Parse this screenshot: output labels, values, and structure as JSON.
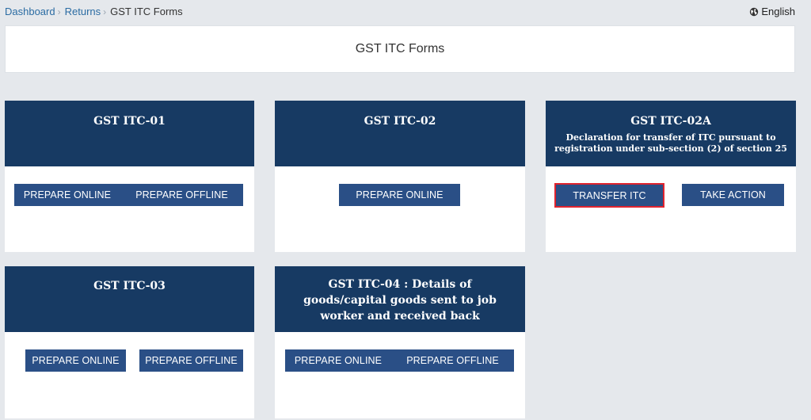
{
  "breadcrumb": {
    "items": [
      "Dashboard",
      "Returns"
    ],
    "current": "GST ITC Forms",
    "separator": "›"
  },
  "language": {
    "label": "English",
    "icon": "globe-icon"
  },
  "page_title": "GST ITC Forms",
  "cards": {
    "itc01": {
      "title": "GST ITC-01",
      "btn1": "PREPARE ONLINE",
      "btn2": "PREPARE OFFLINE"
    },
    "itc02": {
      "title": "GST ITC-02",
      "btn1": "PREPARE ONLINE"
    },
    "itc02a": {
      "title": "GST ITC-02A",
      "subtitle_line1": "Declaration for transfer of ITC pursuant to",
      "subtitle_line2": "registration under sub-section (2) of section 25",
      "btn1": "TRANSFER ITC",
      "btn2": "TAKE ACTION"
    },
    "itc03": {
      "title": "GST ITC-03",
      "btn1": "PREPARE ONLINE",
      "btn2": "PREPARE OFFLINE"
    },
    "itc04": {
      "title_line1": "GST ITC-04 : Details of",
      "title_line2": "goods/capital goods sent to job",
      "title_line3": "worker and received back",
      "btn1": "PREPARE ONLINE",
      "btn2": "PREPARE OFFLINE"
    }
  },
  "colors": {
    "background": "#e5e8ec",
    "card_header": "#173a63",
    "button": "#2a4f86",
    "link": "#2b6ca3",
    "highlight": "#e0232e"
  }
}
